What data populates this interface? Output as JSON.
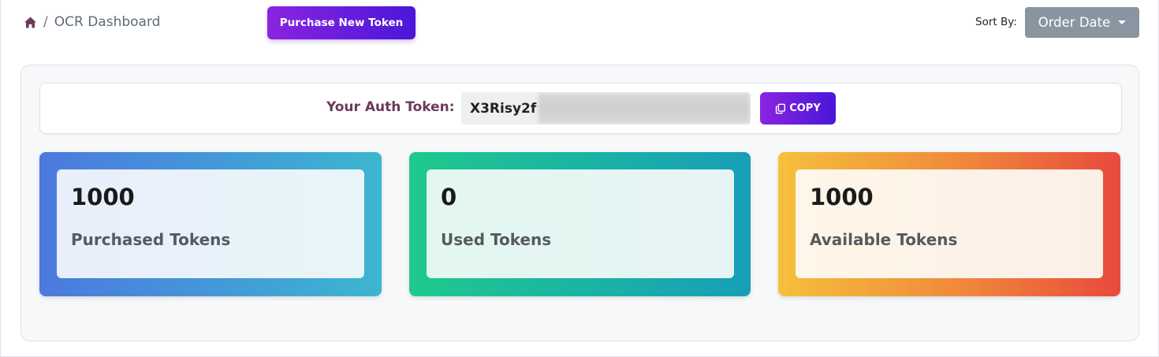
{
  "breadcrumb": {
    "home_icon": "home-icon",
    "separator": "/",
    "current": "OCR Dashboard"
  },
  "header": {
    "purchase_button_label": "Purchase New Token",
    "sort_label": "Sort By:",
    "sort_selected": "Order Date"
  },
  "auth": {
    "label": "Your Auth Token:",
    "token_visible": "X3Risy2f",
    "token_obscured": true,
    "copy_icon": "copy-icon",
    "copy_label": "COPY"
  },
  "stats": [
    {
      "value": "1000",
      "label": "Purchased Tokens"
    },
    {
      "value": "0",
      "label": "Used Tokens"
    },
    {
      "value": "1000",
      "label": "Available Tokens"
    }
  ],
  "colors": {
    "accent_purple_start": "#8a24e0",
    "accent_purple_end": "#4b16d9",
    "sort_button": "#8995a0",
    "token_label": "#6b3a5b",
    "purchased_gradient": [
      "#4c79e0",
      "#3cb6d0"
    ],
    "used_gradient": [
      "#1fc98d",
      "#169fb8"
    ],
    "available_gradient": [
      "#f5c03c",
      "#e84a3c"
    ]
  }
}
